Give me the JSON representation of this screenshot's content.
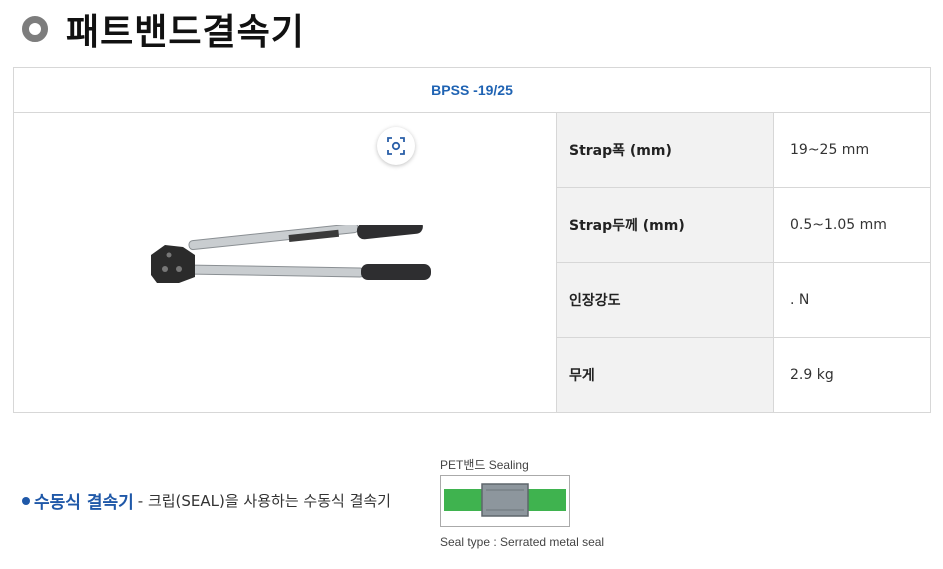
{
  "heading": {
    "title": "패트밴드결속기",
    "icon": "ring-icon"
  },
  "spec_table": {
    "model": "BPSS -19/25",
    "rows": [
      {
        "label": "Strap폭 (mm)",
        "value": "19~25 mm"
      },
      {
        "label": "Strap두께 (mm)",
        "value": "0.5~1.05 mm"
      },
      {
        "label": "인장강도",
        "value": ". N"
      },
      {
        "label": "무게",
        "value": "2.9 kg"
      }
    ]
  },
  "image_overlay": {
    "icon": "lens-scan-icon"
  },
  "product_image": {
    "icon": "strapping-tool-image"
  },
  "bottom": {
    "title": "수동식 결속기",
    "description": "- 크립(SEAL)을 사용하는 수동식 결속기",
    "seal_label_top": "PET밴드 Sealing",
    "seal_label_bottom": "Seal type : Serrated metal seal"
  },
  "colors": {
    "accent": "#1f63b3",
    "strap_green": "#3fb34f",
    "label_bg": "#f2f2f2"
  }
}
